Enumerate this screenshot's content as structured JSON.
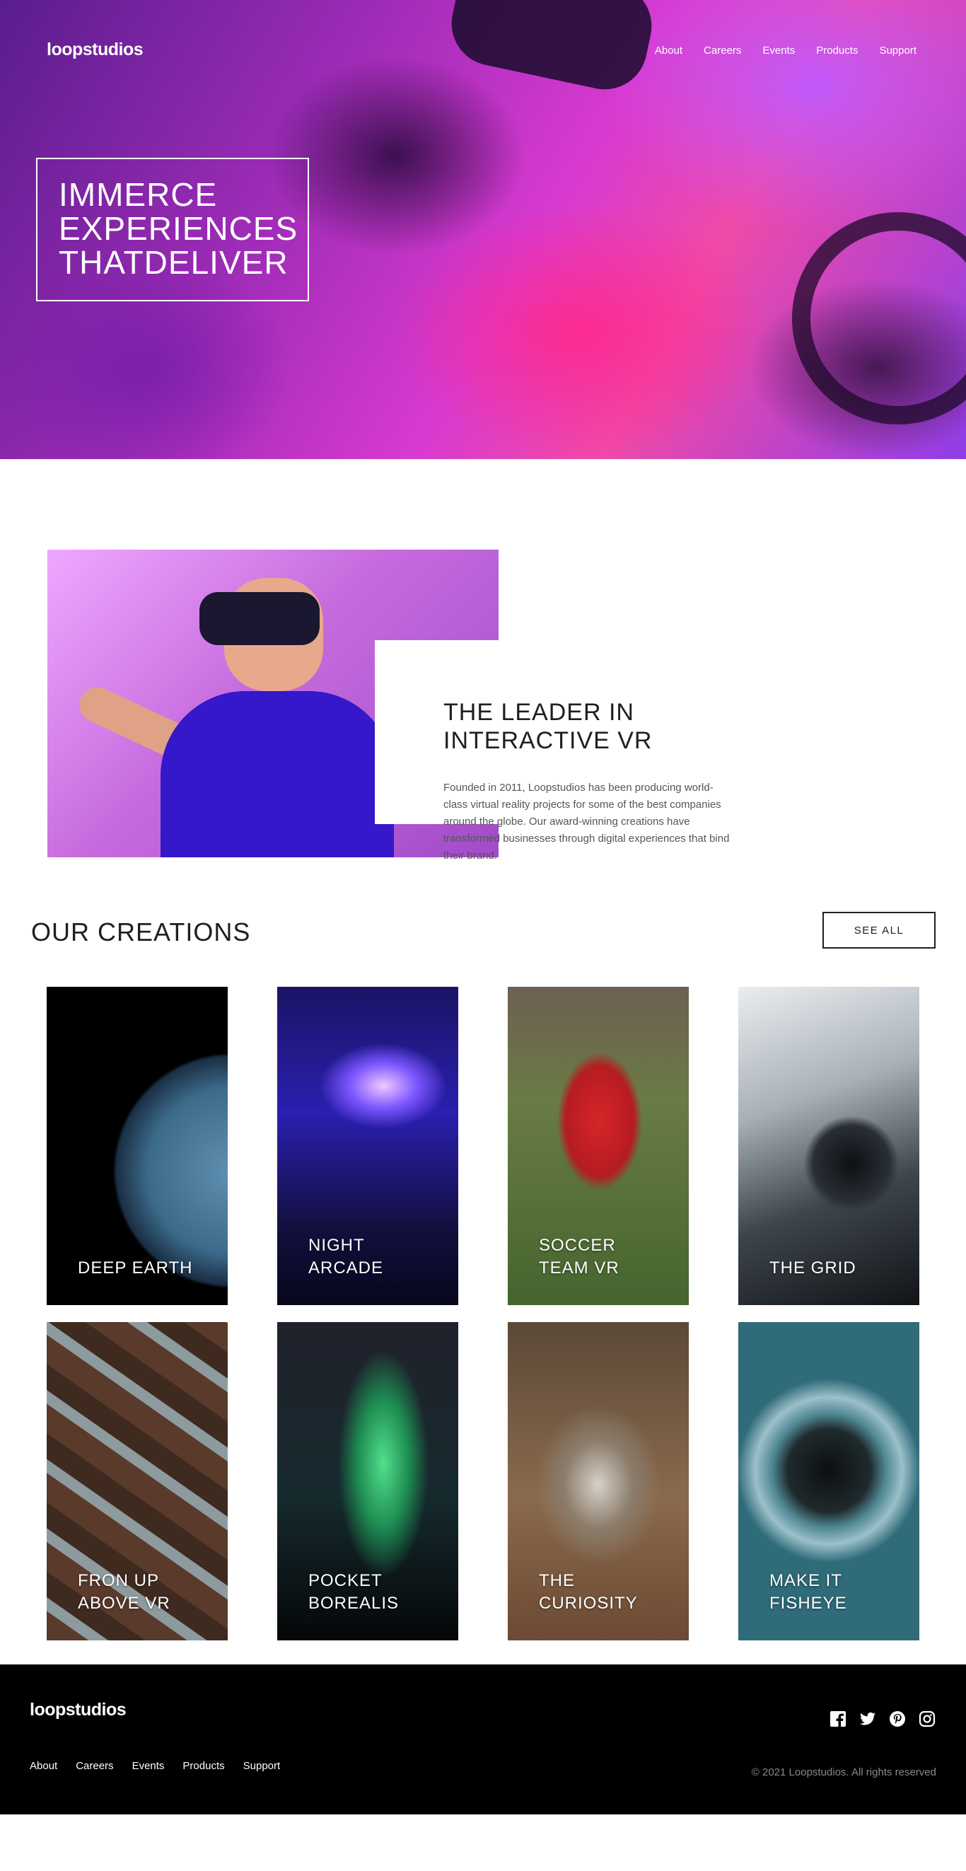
{
  "header": {
    "logo": "loopstudios",
    "nav": [
      "About",
      "Careers",
      "Events",
      "Products",
      "Support"
    ]
  },
  "hero": {
    "headline_lines": [
      "IMMERCE",
      "EXPERIENCES",
      "THATDELIVER"
    ]
  },
  "interactive": {
    "title": "THE LEADER IN INTERACTIVE VR",
    "text": "Founded in 2011, Loopstudios has been producing world-class virtual reality projects for some of the best companies around the globe. Our award-winning creations have transformed businesses through digital experiences that bind their brand."
  },
  "creations": {
    "title": "OUR CREATIONS",
    "see_all": "SEE ALL",
    "cards": [
      {
        "title": "DEEP EARTH"
      },
      {
        "title": "NIGHT ARCADE"
      },
      {
        "title": "SOCCER TEAM VR"
      },
      {
        "title": "THE GRID"
      },
      {
        "title": "FRON UP ABOVE VR"
      },
      {
        "title": "POCKET BOREALIS"
      },
      {
        "title": "THE CURIOSITY"
      },
      {
        "title": "MAKE IT FISHEYE"
      }
    ]
  },
  "footer": {
    "logo": "loopstudios",
    "nav": [
      "About",
      "Careers",
      "Events",
      "Products",
      "Support"
    ],
    "social_icons": [
      "facebook-icon",
      "twitter-icon",
      "pinterest-icon",
      "instagram-icon"
    ],
    "copyright": "© 2021 Loopstudios. All rights reserved"
  }
}
